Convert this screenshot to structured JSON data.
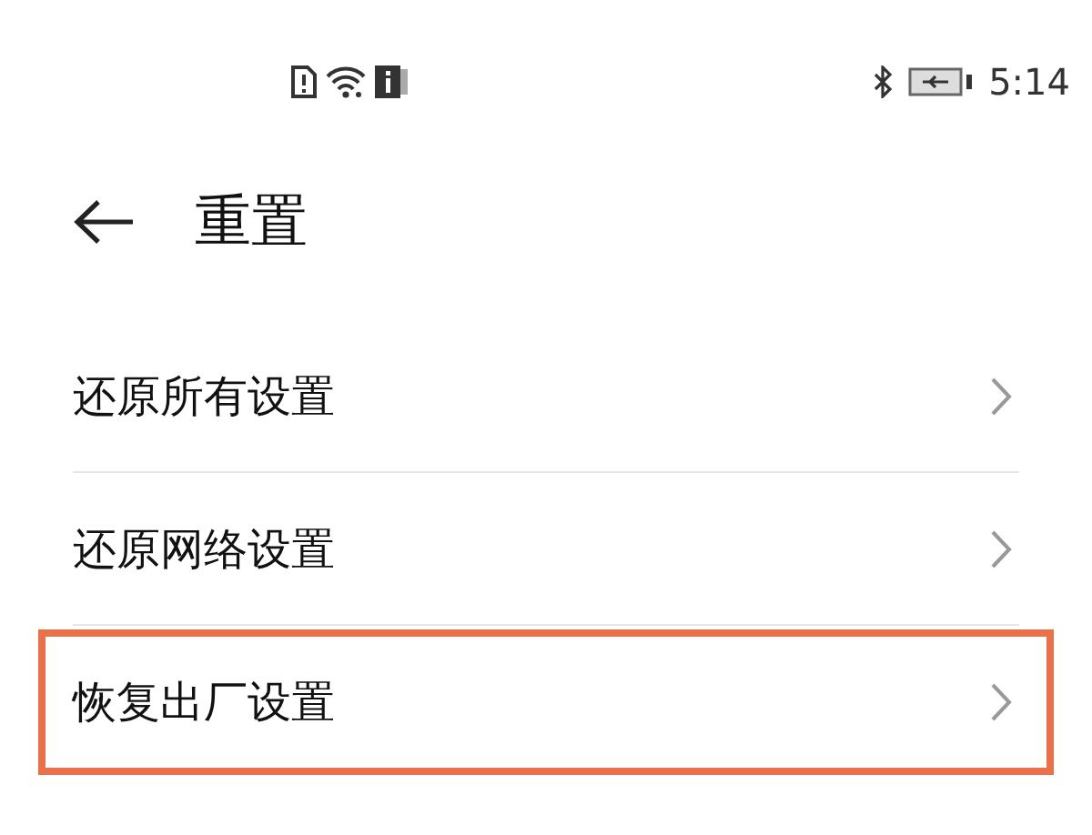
{
  "status_bar": {
    "time": "5:14"
  },
  "header": {
    "title": "重置"
  },
  "items": [
    {
      "label": "还原所有设置",
      "highlighted": false
    },
    {
      "label": "还原网络设置",
      "highlighted": false
    },
    {
      "label": "恢复出厂设置",
      "highlighted": true
    }
  ]
}
